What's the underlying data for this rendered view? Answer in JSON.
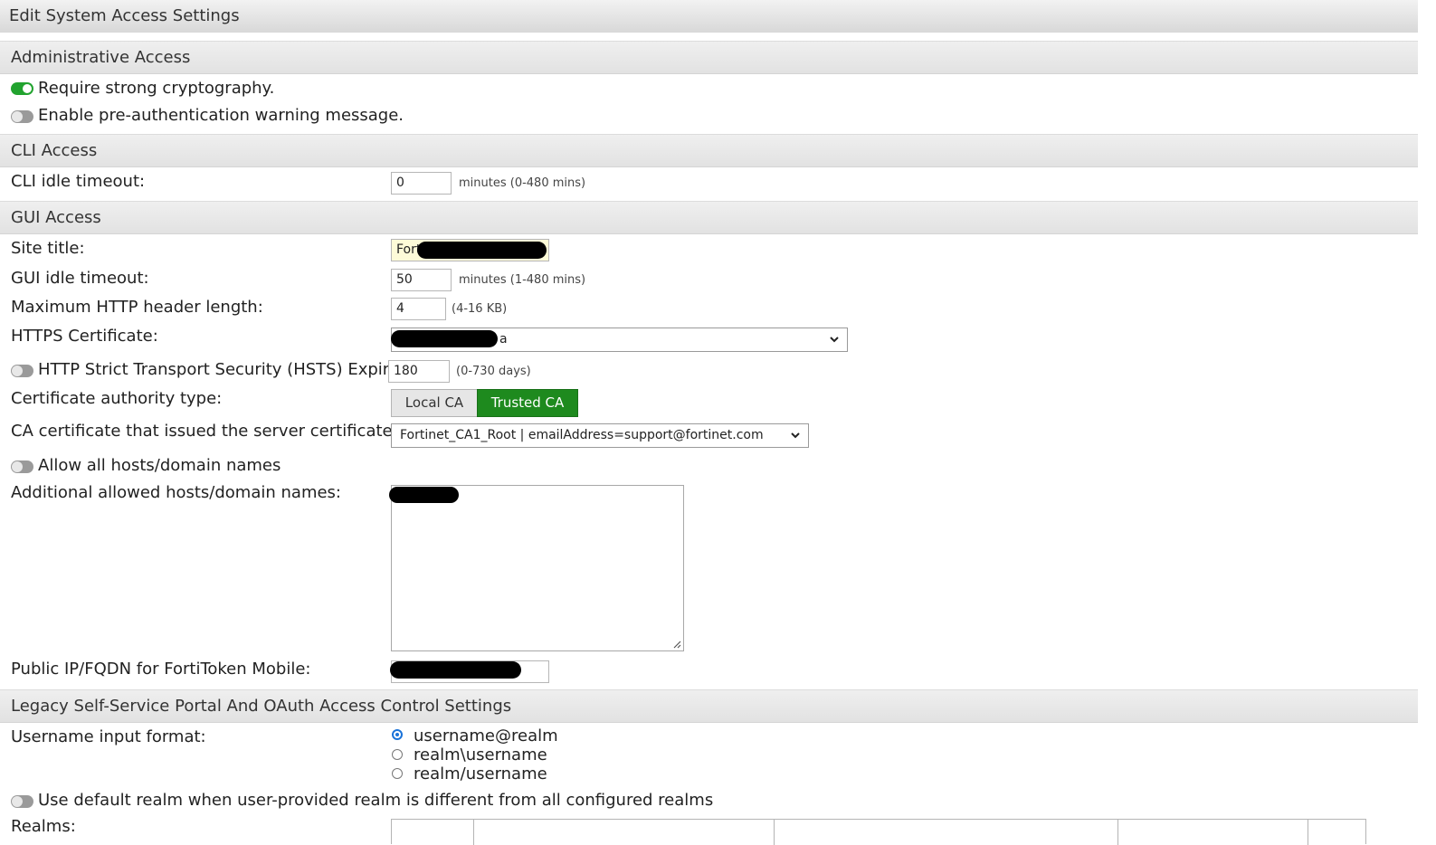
{
  "window": {
    "title": "Edit System Access Settings"
  },
  "admin": {
    "heading": "Administrative Access",
    "strong_crypto": {
      "label": "Require strong cryptography.",
      "enabled": true
    },
    "pre_auth_warning": {
      "label": "Enable pre-authentication warning message.",
      "enabled": false
    }
  },
  "cli": {
    "heading": "CLI Access",
    "idle_timeout": {
      "label": "CLI idle timeout:",
      "value": "0",
      "hint": "minutes (0-480 mins)"
    }
  },
  "gui": {
    "heading": "GUI Access",
    "site_title": {
      "label": "Site title:",
      "value": "Fort"
    },
    "idle_timeout": {
      "label": "GUI idle timeout:",
      "value": "50",
      "hint": "minutes (1-480 mins)"
    },
    "http_header": {
      "label": "Maximum HTTP header length:",
      "value": "4",
      "hint": "(4-16 KB)"
    },
    "https_cert": {
      "label": "HTTPS Certificate:",
      "value": "a"
    },
    "hsts": {
      "label": "HTTP Strict Transport Security (HSTS) Expiry",
      "enabled": false,
      "value": "180",
      "hint": "(0-730 days)"
    },
    "ca_type": {
      "label": "Certificate authority type:",
      "options": [
        "Local CA",
        "Trusted CA"
      ],
      "selected": "Trusted CA"
    },
    "ca_cert": {
      "label": "CA certificate that issued the server certificate:",
      "value": "Fortinet_CA1_Root | emailAddress=support@fortinet.com"
    },
    "allow_all_hosts": {
      "label": "Allow all hosts/domain names",
      "enabled": false
    },
    "additional_hosts": {
      "label": "Additional allowed hosts/domain names:"
    },
    "fortitoken": {
      "label": "Public IP/FQDN for FortiToken Mobile:"
    }
  },
  "legacy": {
    "heading": "Legacy Self-Service Portal And OAuth Access Control Settings",
    "username_format": {
      "label": "Username input format:",
      "options": [
        "username@realm",
        "realm\\username",
        "realm/username"
      ],
      "selected": "username@realm"
    },
    "default_realm": {
      "label": "Use default realm when user-provided realm is different from all configured realms",
      "enabled": false
    },
    "realms": {
      "label": "Realms:"
    }
  },
  "colors": {
    "accent_green": "#1e8a1e",
    "toggle_on": "#22a32f",
    "radio_blue": "#1a73d9"
  }
}
